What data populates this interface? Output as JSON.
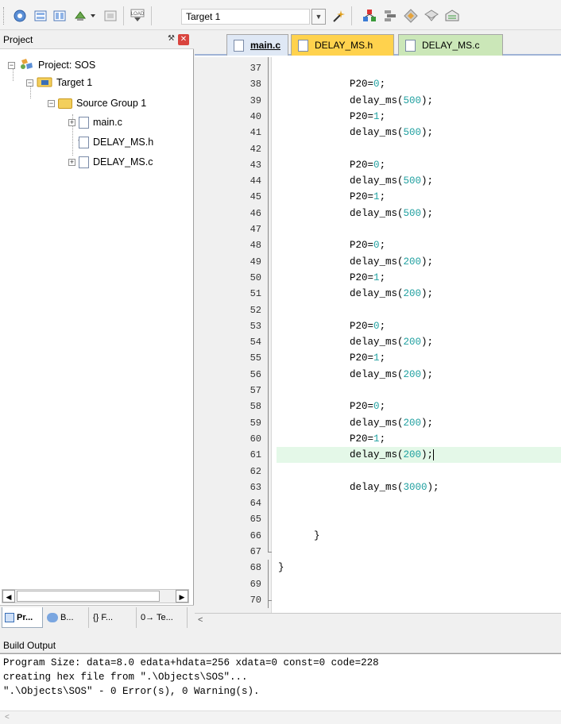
{
  "toolbar": {
    "target_name": "Target 1",
    "icons": [
      "build-target-icon",
      "batch-build-icon",
      "rebuild-icon",
      "translate-icon",
      "stop-build-icon",
      "download-icon",
      "options-icon",
      "manage-components-icon",
      "select-packs-icon",
      "pack-installer-icon",
      "project-books-icon",
      "manage-runtime-icon"
    ]
  },
  "project_panel": {
    "title": "Project",
    "tree": [
      {
        "label": "Project: SOS",
        "level": 0
      },
      {
        "label": "Target 1",
        "level": 1
      },
      {
        "label": "Source Group 1",
        "level": 2
      },
      {
        "label": "main.c",
        "level": 3
      },
      {
        "label": "DELAY_MS.h",
        "level": 3
      },
      {
        "label": "DELAY_MS.c",
        "level": 3
      }
    ],
    "bottom_tabs": [
      "Pr...",
      "B...",
      "{} F...",
      "0→ Te..."
    ]
  },
  "editor": {
    "tabs": [
      {
        "label": "main.c",
        "active": true
      },
      {
        "label": "DELAY_MS.h",
        "active": false
      },
      {
        "label": "DELAY_MS.c",
        "active": false
      }
    ],
    "lines": [
      {
        "n": "37",
        "code": "",
        "indent": 0
      },
      {
        "n": "38",
        "code": "P20=0;",
        "indent": 12
      },
      {
        "n": "39",
        "code": "delay_ms(500);",
        "indent": 12
      },
      {
        "n": "40",
        "code": "P20=1;",
        "indent": 12
      },
      {
        "n": "41",
        "code": "delay_ms(500);",
        "indent": 12
      },
      {
        "n": "42",
        "code": "",
        "indent": 0
      },
      {
        "n": "43",
        "code": "P20=0;",
        "indent": 12
      },
      {
        "n": "44",
        "code": "delay_ms(500);",
        "indent": 12
      },
      {
        "n": "45",
        "code": "P20=1;",
        "indent": 12
      },
      {
        "n": "46",
        "code": "delay_ms(500);",
        "indent": 12
      },
      {
        "n": "47",
        "code": "",
        "indent": 0
      },
      {
        "n": "48",
        "code": "P20=0;",
        "indent": 12
      },
      {
        "n": "49",
        "code": "delay_ms(200);",
        "indent": 12
      },
      {
        "n": "50",
        "code": "P20=1;",
        "indent": 12
      },
      {
        "n": "51",
        "code": "delay_ms(200);",
        "indent": 12
      },
      {
        "n": "52",
        "code": "",
        "indent": 0
      },
      {
        "n": "53",
        "code": "P20=0;",
        "indent": 12
      },
      {
        "n": "54",
        "code": "delay_ms(200);",
        "indent": 12
      },
      {
        "n": "55",
        "code": "P20=1;",
        "indent": 12
      },
      {
        "n": "56",
        "code": "delay_ms(200);",
        "indent": 12
      },
      {
        "n": "57",
        "code": "",
        "indent": 0
      },
      {
        "n": "58",
        "code": "P20=0;",
        "indent": 12
      },
      {
        "n": "59",
        "code": "delay_ms(200);",
        "indent": 12
      },
      {
        "n": "60",
        "code": "P20=1;",
        "indent": 12
      },
      {
        "n": "61",
        "code": "delay_ms(200);",
        "indent": 12,
        "highlight": true
      },
      {
        "n": "62",
        "code": "",
        "indent": 0
      },
      {
        "n": "63",
        "code": "delay_ms(3000);",
        "indent": 12
      },
      {
        "n": "64",
        "code": "",
        "indent": 0
      },
      {
        "n": "65",
        "code": "",
        "indent": 0
      },
      {
        "n": "66",
        "code": "}",
        "indent": 6
      },
      {
        "n": "67",
        "code": "",
        "indent": 0
      },
      {
        "n": "68",
        "code": "}",
        "indent": 0
      },
      {
        "n": "69",
        "code": "",
        "indent": 0
      },
      {
        "n": "70",
        "code": "",
        "indent": 0
      }
    ]
  },
  "build_output": {
    "title": "Build Output",
    "lines": [
      "Program Size: data=8.0 edata+hdata=256 xdata=0 const=0 code=228",
      "creating hex file from \".\\Objects\\SOS\"...",
      "\".\\Objects\\SOS\" - 0 Error(s), 0 Warning(s)."
    ],
    "scroll_left": "<"
  },
  "colors": {
    "number": "#20a0a0",
    "highlight_line": "#e4f8e8",
    "tab_main": "#dfe8f5",
    "tab_h": "#ffd24d",
    "tab_c": "#cbe7b8"
  }
}
